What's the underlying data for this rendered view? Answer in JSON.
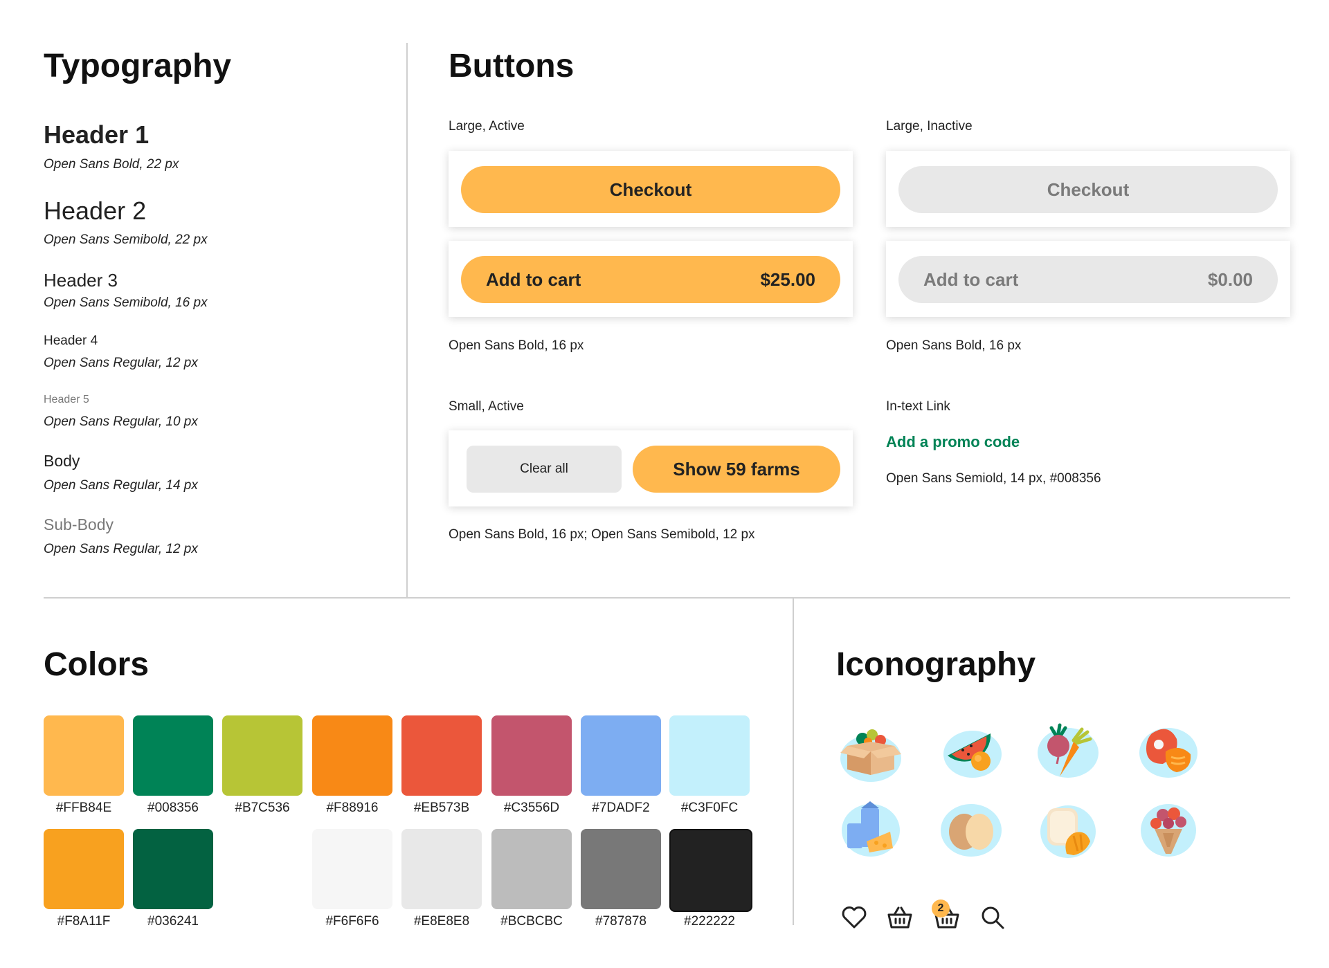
{
  "typography": {
    "title": "Typography",
    "styles": [
      {
        "name": "Header 1",
        "spec": "Open Sans Bold, 22 px"
      },
      {
        "name": "Header 2",
        "spec": "Open Sans Semibold, 22 px"
      },
      {
        "name": "Header 3",
        "spec": "Open Sans Semibold, 16 px"
      },
      {
        "name": "Header 4",
        "spec": "Open Sans Regular, 12 px"
      },
      {
        "name": "Header 5",
        "spec": "Open Sans Regular, 10 px"
      },
      {
        "name": "Body",
        "spec": "Open Sans Regular, 14 px"
      },
      {
        "name": "Sub-Body",
        "spec": "Open Sans Regular, 12 px"
      }
    ]
  },
  "buttons": {
    "title": "Buttons",
    "large_active": {
      "label": "Large, Active",
      "checkout": "Checkout",
      "add_to_cart": "Add to cart",
      "price": "$25.00",
      "spec": "Open Sans Bold, 16 px"
    },
    "large_inactive": {
      "label": "Large, Inactive",
      "checkout": "Checkout",
      "add_to_cart": "Add to cart",
      "price": "$0.00",
      "spec": "Open Sans Bold, 16 px"
    },
    "small_active": {
      "label": "Small, Active",
      "clear": "Clear all",
      "show": "Show 59 farms",
      "spec": "Open Sans Bold, 16 px; Open Sans Semibold, 12 px"
    },
    "in_text_link": {
      "label": "In-text Link",
      "link": "Add a promo code",
      "spec": "Open Sans Semiold, 14 px, #008356"
    }
  },
  "colors": {
    "title": "Colors",
    "row1": [
      {
        "hex": "#FFB84E",
        "label": "#FFB84E"
      },
      {
        "hex": "#008356",
        "label": "#008356"
      },
      {
        "hex": "#B7C536",
        "label": "#B7C536"
      },
      {
        "hex": "#F88916",
        "label": "#F88916"
      },
      {
        "hex": "#EB573B",
        "label": "#EB573B"
      },
      {
        "hex": "#C3556D",
        "label": "#C3556D"
      },
      {
        "hex": "#7DADF2",
        "label": "#7DADF2"
      },
      {
        "hex": "#C3F0FC",
        "label": "#C3F0FC"
      }
    ],
    "row2": [
      {
        "hex": "#F8A11F",
        "label": "#F8A11F"
      },
      {
        "hex": "#036241",
        "label": "#036241"
      },
      {
        "hex": "#F6F6F6",
        "label": "#F6F6F6"
      },
      {
        "hex": "#E8E8E8",
        "label": "#E8E8E8"
      },
      {
        "hex": "#BCBCBC",
        "label": "#BCBCBC"
      },
      {
        "hex": "#787878",
        "label": "#787878"
      },
      {
        "hex": "#222222",
        "label": "#222222"
      }
    ]
  },
  "iconography": {
    "title": "Iconography",
    "category_icons": [
      "produce-box-icon",
      "fruit-icon",
      "vegetable-icon",
      "meat-fish-icon",
      "dairy-icon",
      "eggs-icon",
      "bakery-icon",
      "flowers-icon"
    ],
    "ui_icons": [
      "heart-icon",
      "basket-icon",
      "basket-with-count-icon",
      "search-icon"
    ],
    "basket_count": "2"
  }
}
